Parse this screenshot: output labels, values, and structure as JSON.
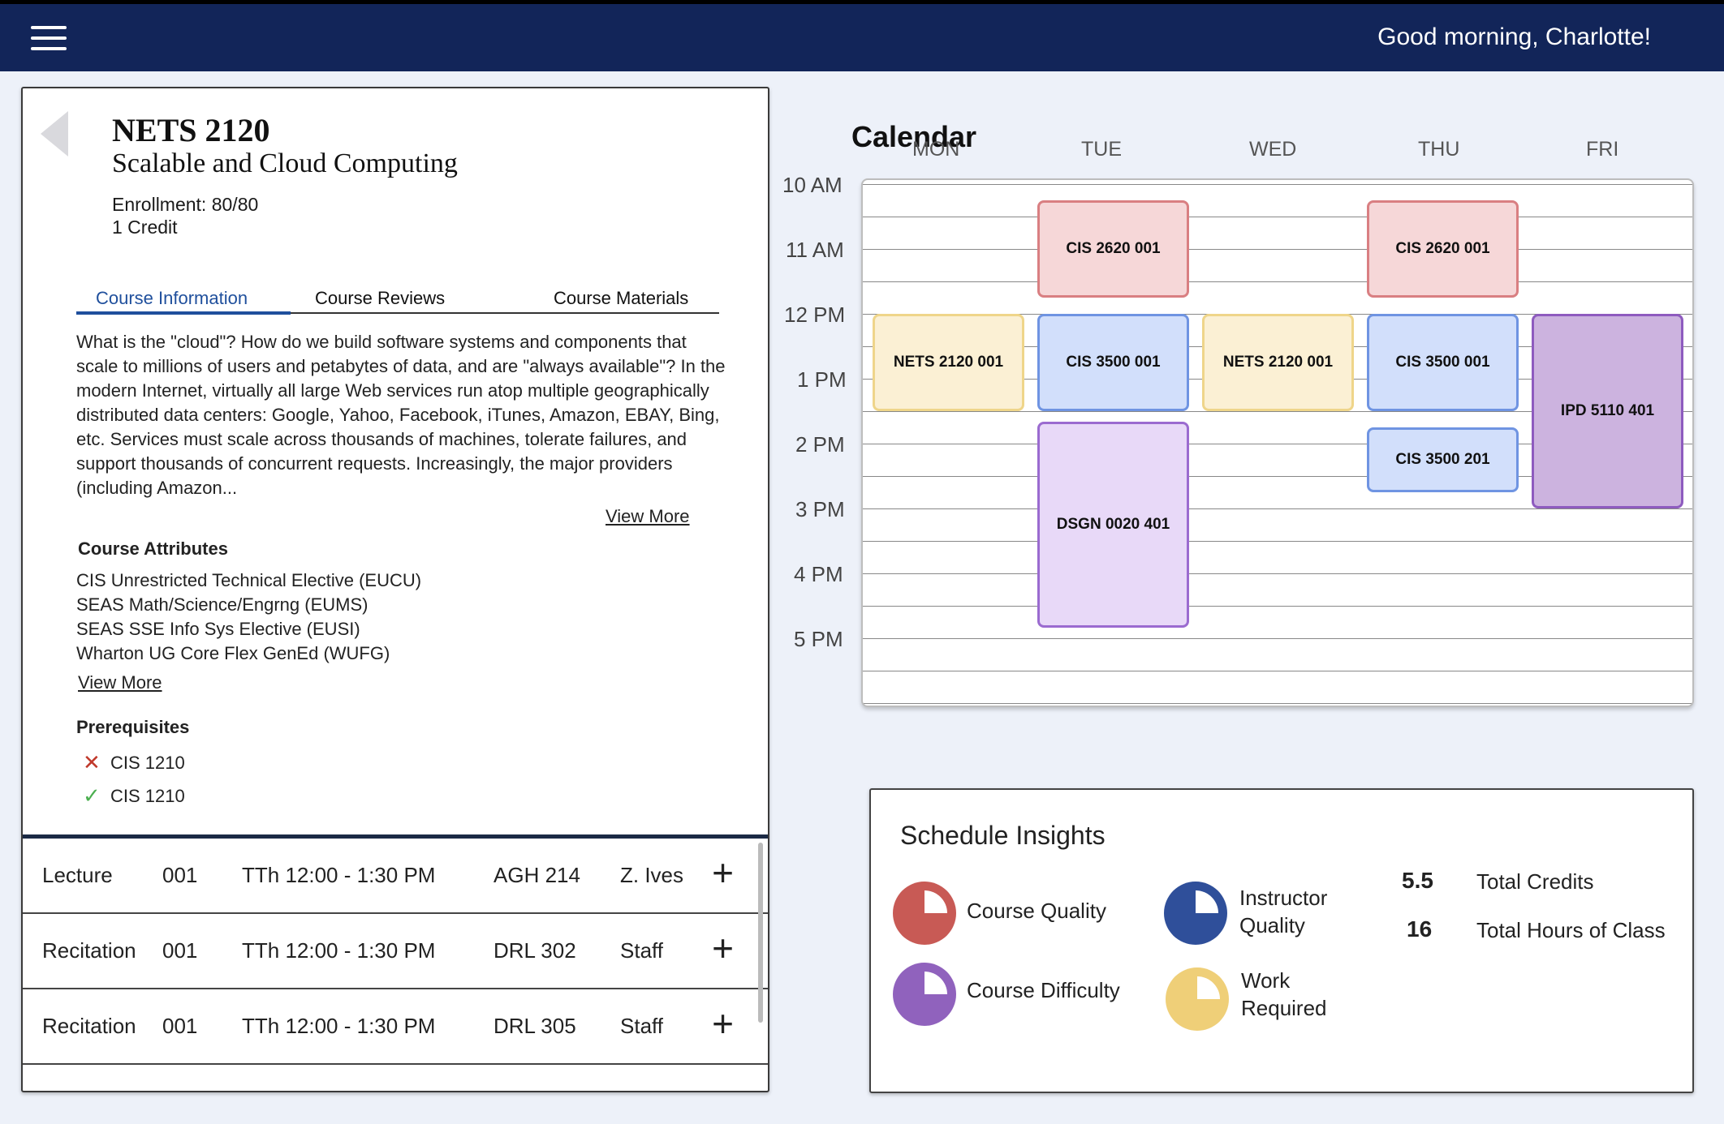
{
  "header": {
    "greeting": "Good morning, Charlotte!"
  },
  "course": {
    "code": "NETS 2120",
    "name": "Scalable and Cloud Computing",
    "enrollment": "Enrollment: 80/80",
    "credits": "1 Credit",
    "tabs": [
      "Course Information",
      "Course Reviews",
      "Course Materials"
    ],
    "active_tab": "Course Information",
    "description": "What is the \"cloud\"? How do we build software systems and components that scale to millions of users and petabytes of data, and are \"always available\"? In the modern Internet, virtually all large Web services run atop multiple geographically distributed data centers: Google, Yahoo, Facebook, iTunes, Amazon, EBAY, Bing, etc. Services must scale across thousands of machines, tolerate failures, and support thousands of concurrent requests. Increasingly, the major providers (including Amazon...",
    "view_more": "View More",
    "attributes_heading": "Course Attributes",
    "attributes": [
      "CIS Unrestricted Technical Elective (EUCU)",
      "SEAS Math/Science/Engrng (EUMS)",
      "SEAS SSE Info Sys Elective (EUSI)",
      "Wharton UG Core Flex GenEd (WUFG)"
    ],
    "prereq_heading": "Prerequisites",
    "prerequisites": [
      {
        "name": "CIS 1210",
        "met": false
      },
      {
        "name": "CIS 1210",
        "met": true
      }
    ],
    "sections": [
      {
        "type": "Lecture",
        "number": "001",
        "time": "TTh 12:00 - 1:30 PM",
        "room": "AGH 214",
        "instructor": "Z. Ives"
      },
      {
        "type": "Recitation",
        "number": "001",
        "time": "TTh 12:00 - 1:30 PM",
        "room": "DRL 302",
        "instructor": "Staff"
      },
      {
        "type": "Recitation",
        "number": "001",
        "time": "TTh 12:00 - 1:30 PM",
        "room": "DRL 305",
        "instructor": "Staff"
      }
    ]
  },
  "calendar": {
    "title": "Calendar",
    "days": [
      "MON",
      "TUE",
      "WED",
      "THU",
      "FRI"
    ],
    "times": [
      "10 AM",
      "11 AM",
      "12 PM",
      "1 PM",
      "2 PM",
      "3 PM",
      "4 PM",
      "5 PM"
    ],
    "events": [
      {
        "label": "CIS 2620 001",
        "day": "TUE",
        "start": "10:15 AM",
        "end": "11:45 AM",
        "color": "#f6d7d8",
        "border": "#d97f82"
      },
      {
        "label": "CIS 2620 001",
        "day": "THU",
        "start": "10:15 AM",
        "end": "11:45 AM",
        "color": "#f6d7d8",
        "border": "#d97f82"
      },
      {
        "label": "NETS 2120 001",
        "day": "MON",
        "start": "12:00 PM",
        "end": "1:30 PM",
        "color": "#fbf0d4",
        "border": "#efd58a"
      },
      {
        "label": "CIS 3500 001",
        "day": "TUE",
        "start": "12:00 PM",
        "end": "1:30 PM",
        "color": "#d2dffb",
        "border": "#6f94e2"
      },
      {
        "label": "NETS 2120 001",
        "day": "WED",
        "start": "12:00 PM",
        "end": "1:30 PM",
        "color": "#fbf0d4",
        "border": "#efd58a"
      },
      {
        "label": "CIS 3500 001",
        "day": "THU",
        "start": "12:00 PM",
        "end": "1:30 PM",
        "color": "#d2dffb",
        "border": "#6f94e2"
      },
      {
        "label": "IPD 5110 401",
        "day": "FRI",
        "start": "12:00 PM",
        "end": "3:00 PM",
        "color": "#ccb3df",
        "border": "#8e5bbf"
      },
      {
        "label": "CIS 3500 201",
        "day": "THU",
        "start": "1:45 PM",
        "end": "2:45 PM",
        "color": "#d2dffb",
        "border": "#6f94e2"
      },
      {
        "label": "DSGN 0020 401",
        "day": "TUE",
        "start": "1:40 PM",
        "end": "4:50 PM",
        "color": "#e8d9f8",
        "border": "#9b6bd0"
      }
    ]
  },
  "insights": {
    "title": "Schedule Insights",
    "metrics": [
      {
        "label": "Course Quality",
        "color": "#c85a55"
      },
      {
        "label": "Instructor Quality",
        "color": "#2f4f9a"
      },
      {
        "label": "Course Difficulty",
        "color": "#9062bd"
      },
      {
        "label": "Work Required",
        "color": "#efcf78"
      }
    ],
    "total_credits": "5.5",
    "total_credits_label": "Total Credits",
    "total_hours": "16",
    "total_hours_label": "Total Hours of Class"
  }
}
